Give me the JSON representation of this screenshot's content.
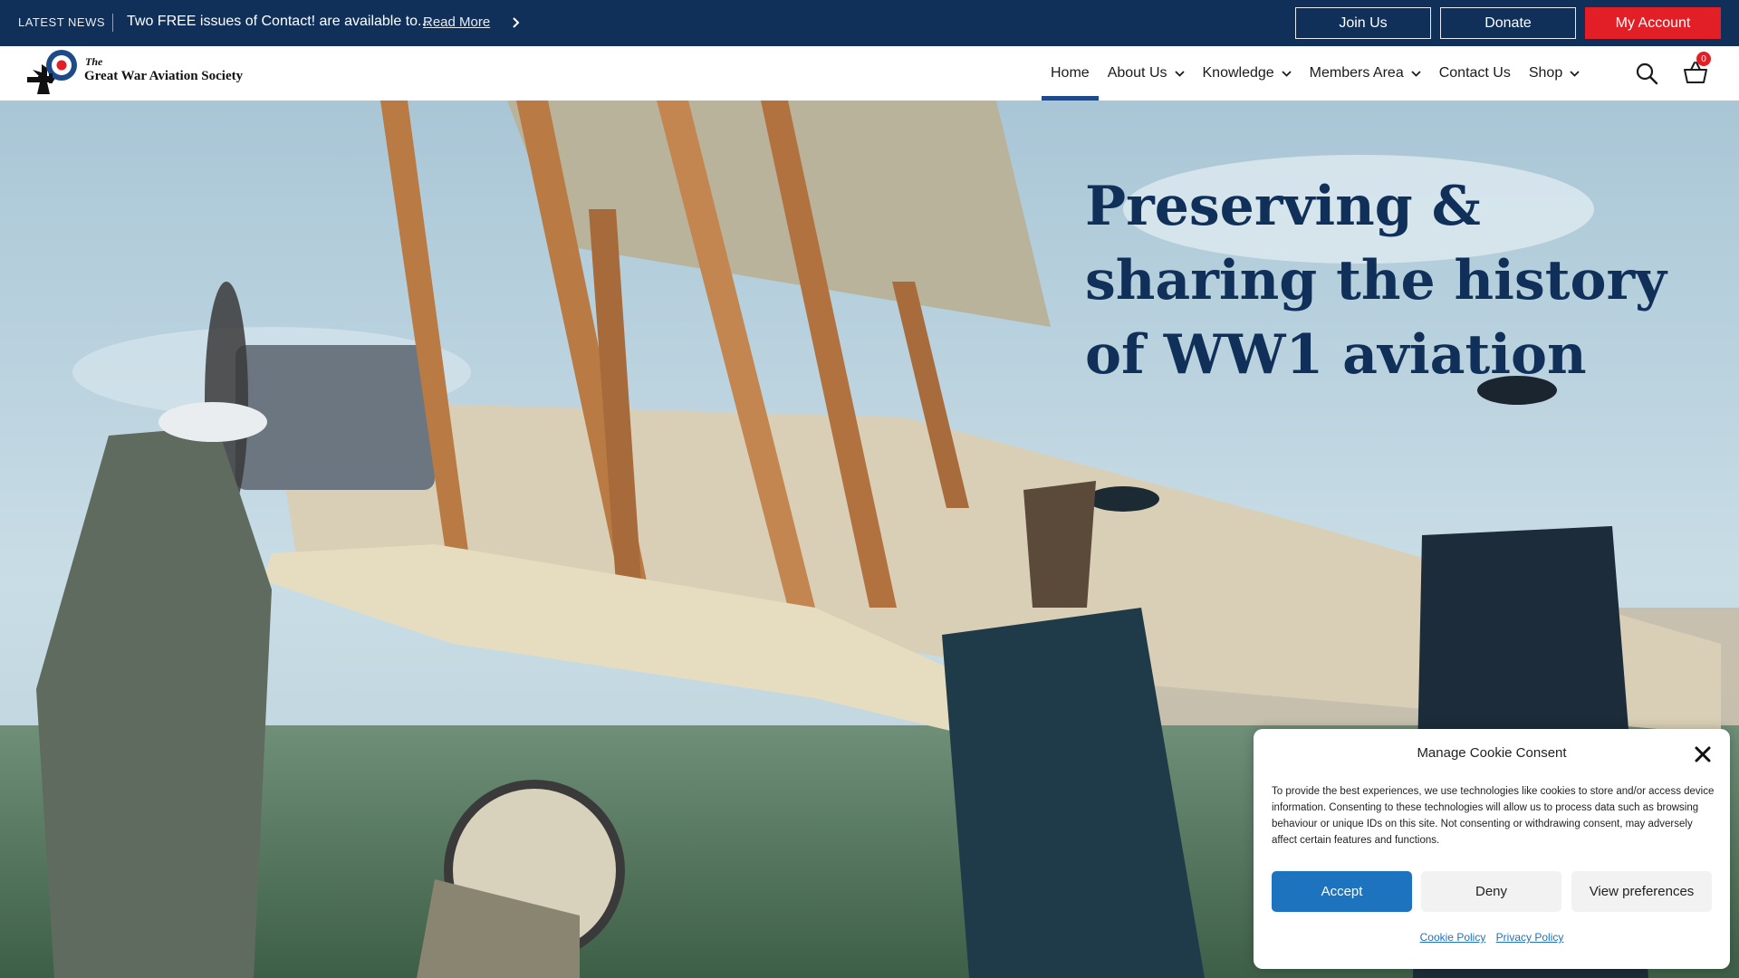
{
  "news": {
    "label": "LATEST NEWS",
    "headline": "Two FREE issues of Contact! are available to...",
    "read_more": "Read More",
    "next_icon": "chevron-right-icon"
  },
  "top_buttons": {
    "join": "Join Us",
    "donate": "Donate",
    "account": "My Account"
  },
  "logo": {
    "the": "The",
    "name": "Great War Aviation Society"
  },
  "nav": [
    {
      "label": "Home",
      "active": true,
      "dropdown": false
    },
    {
      "label": "About Us",
      "active": false,
      "dropdown": true
    },
    {
      "label": "Knowledge",
      "active": false,
      "dropdown": true
    },
    {
      "label": "Members Area",
      "active": false,
      "dropdown": true
    },
    {
      "label": "Contact Us",
      "active": false,
      "dropdown": false
    },
    {
      "label": "Shop",
      "active": false,
      "dropdown": true
    }
  ],
  "cart": {
    "count": "0"
  },
  "hero": {
    "line1": "Preserving &",
    "line2": "sharing the history",
    "line3_prefix": "of ",
    "line3_bold": "WW1 aviation"
  },
  "cookie": {
    "title": "Manage Cookie Consent",
    "text": "To provide the best experiences, we use technologies like cookies to store and/or access device information. Consenting to these technologies will allow us to process data such as browsing behaviour or unique IDs on this site. Not consenting or withdrawing consent, may adversely affect certain features and functions.",
    "accept": "Accept",
    "deny": "Deny",
    "preferences": "View preferences",
    "cookie_policy": "Cookie Policy",
    "privacy_policy": "Privacy Policy"
  },
  "colors": {
    "navy": "#10305a",
    "accent_red": "#e21f26",
    "accept_blue": "#1e73be",
    "nav_active": "#1f4a8a"
  }
}
